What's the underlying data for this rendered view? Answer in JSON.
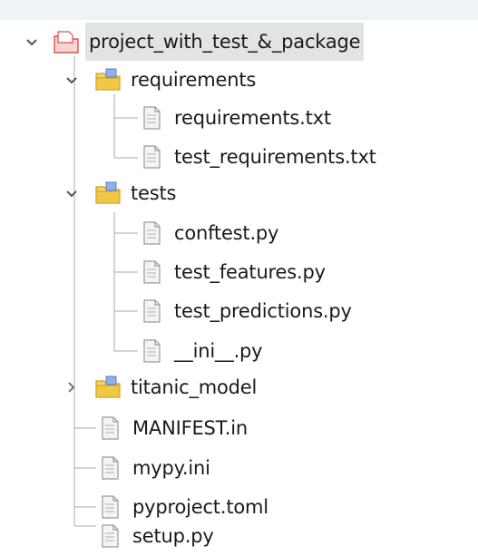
{
  "tree": {
    "root": {
      "label": "project_with_test_&_package",
      "icon": "project-icon",
      "expanded": true,
      "children": {
        "requirements": {
          "label": "requirements",
          "icon": "package-folder-icon",
          "expanded": true,
          "files": [
            "requirements.txt",
            "test_requirements.txt"
          ]
        },
        "tests": {
          "label": "tests",
          "icon": "package-folder-icon",
          "expanded": true,
          "files": [
            "conftest.py",
            "test_features.py",
            "test_predictions.py",
            "__ini__.py"
          ]
        },
        "titanic_model": {
          "label": "titanic_model",
          "icon": "package-folder-icon",
          "expanded": false
        },
        "files": [
          "MANIFEST.in",
          "mypy.ini",
          "pyproject.toml",
          "setup.py"
        ]
      }
    }
  },
  "colors": {
    "selection_bg": "#e3e3e3",
    "folder_yellow": "#f2c744",
    "folder_blue": "#5b7fc2",
    "project_red": "#d9534f",
    "guide_line": "#a8a8a8",
    "chevron": "#555555"
  }
}
